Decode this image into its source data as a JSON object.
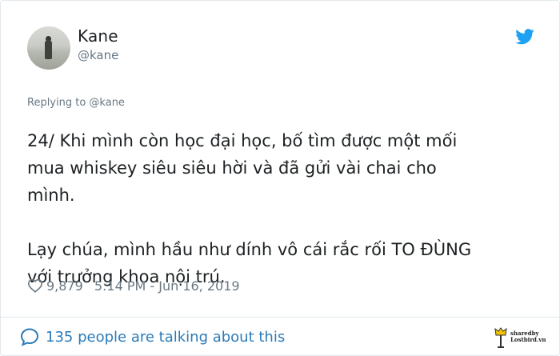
{
  "author": {
    "name": "Kane",
    "handle": "@kane"
  },
  "reply_context": "Replying to @kane",
  "tweet_text": "24/ Khi mình còn học đại học, bố tìm được một mối\nmua whiskey siêu siêu hời và đã gửi vài chai cho\nmình.\n\nLạy chúa, mình hầu như dính vô cái rắc rối TO ĐÙNG\nvới trưởng khoa nội trú.",
  "stats": {
    "likes": "9,879",
    "timestamp": "5:14 PM - Jun 16, 2019"
  },
  "footer": {
    "talking": "135 people are talking about this"
  },
  "watermark": {
    "line1": "sharedby",
    "line2": "Lostbird.vn"
  },
  "colors": {
    "twitter_blue": "#1da1f2",
    "link_blue": "#2b7bb9",
    "muted": "#697882"
  }
}
